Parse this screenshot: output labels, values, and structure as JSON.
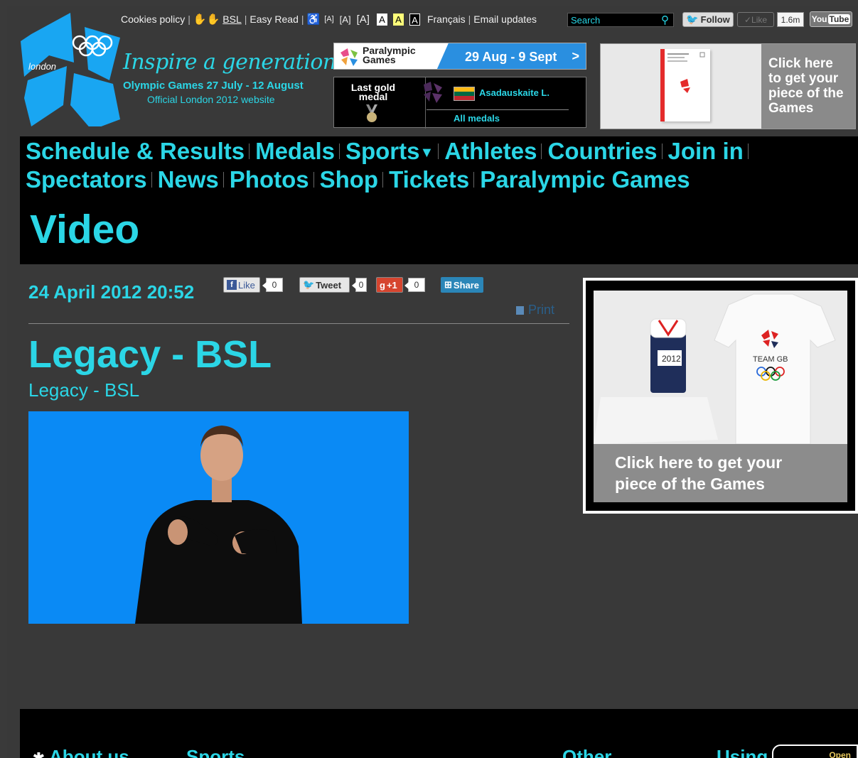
{
  "topbar": {
    "cookies": "Cookies policy",
    "bsl": "BSL",
    "easy_read": "Easy Read",
    "text_sizes": [
      "A",
      "A",
      "A"
    ],
    "contrast": [
      "A",
      "A",
      "A"
    ],
    "francais": "Français",
    "email_updates": "Email updates",
    "search_placeholder": "Search",
    "follow": "Follow",
    "like": "Like",
    "like_count": "1.6m",
    "youtube_you": "You",
    "youtube_tube": "Tube"
  },
  "header": {
    "logo_text": "london",
    "tagline": "Inspire a generation",
    "dates": "Olympic Games 27 July - 12 August",
    "official": "Official London 2012 website"
  },
  "paralympic": {
    "title_line1": "Paralympic",
    "title_line2": "Games",
    "dates": "29 Aug - 9 Sept",
    "chevron": ">"
  },
  "medal": {
    "label_line1": "Last gold",
    "label_line2": "medal",
    "athlete": "Asadauskaite L.",
    "all_medals": "All medals"
  },
  "ad_top": {
    "text": "Click here to get your piece of the Games"
  },
  "nav": {
    "row1": [
      "Schedule & Results",
      "Medals",
      "Sports",
      "Athletes",
      "Countries",
      "Join in"
    ],
    "row2": [
      "Spectators",
      "News",
      "Photos",
      "Shop",
      "Tickets",
      "Paralympic Games"
    ],
    "section": "Video"
  },
  "article": {
    "date": "24 April 2012 20:52",
    "fb_like": "Like",
    "fb_count": "0",
    "tweet": "Tweet",
    "tweet_count": "0",
    "gplus": "+1",
    "gplus_count": "0",
    "share": "Share",
    "print": "Print",
    "title": "Legacy - BSL",
    "subtitle": "Legacy - BSL"
  },
  "ad_side": {
    "caption_line1": "Click here to get your",
    "caption_line2": "piece of the Games",
    "shirt_text": "TEAM GB",
    "bib": "2012"
  },
  "footer": {
    "about": "About us",
    "sports": "Sports",
    "other": "Other",
    "using": "Using",
    "open": "Open"
  },
  "colors": {
    "accent": "#2bd6e6",
    "video_bg": "#0a8af5",
    "page_bg": "#393939"
  }
}
